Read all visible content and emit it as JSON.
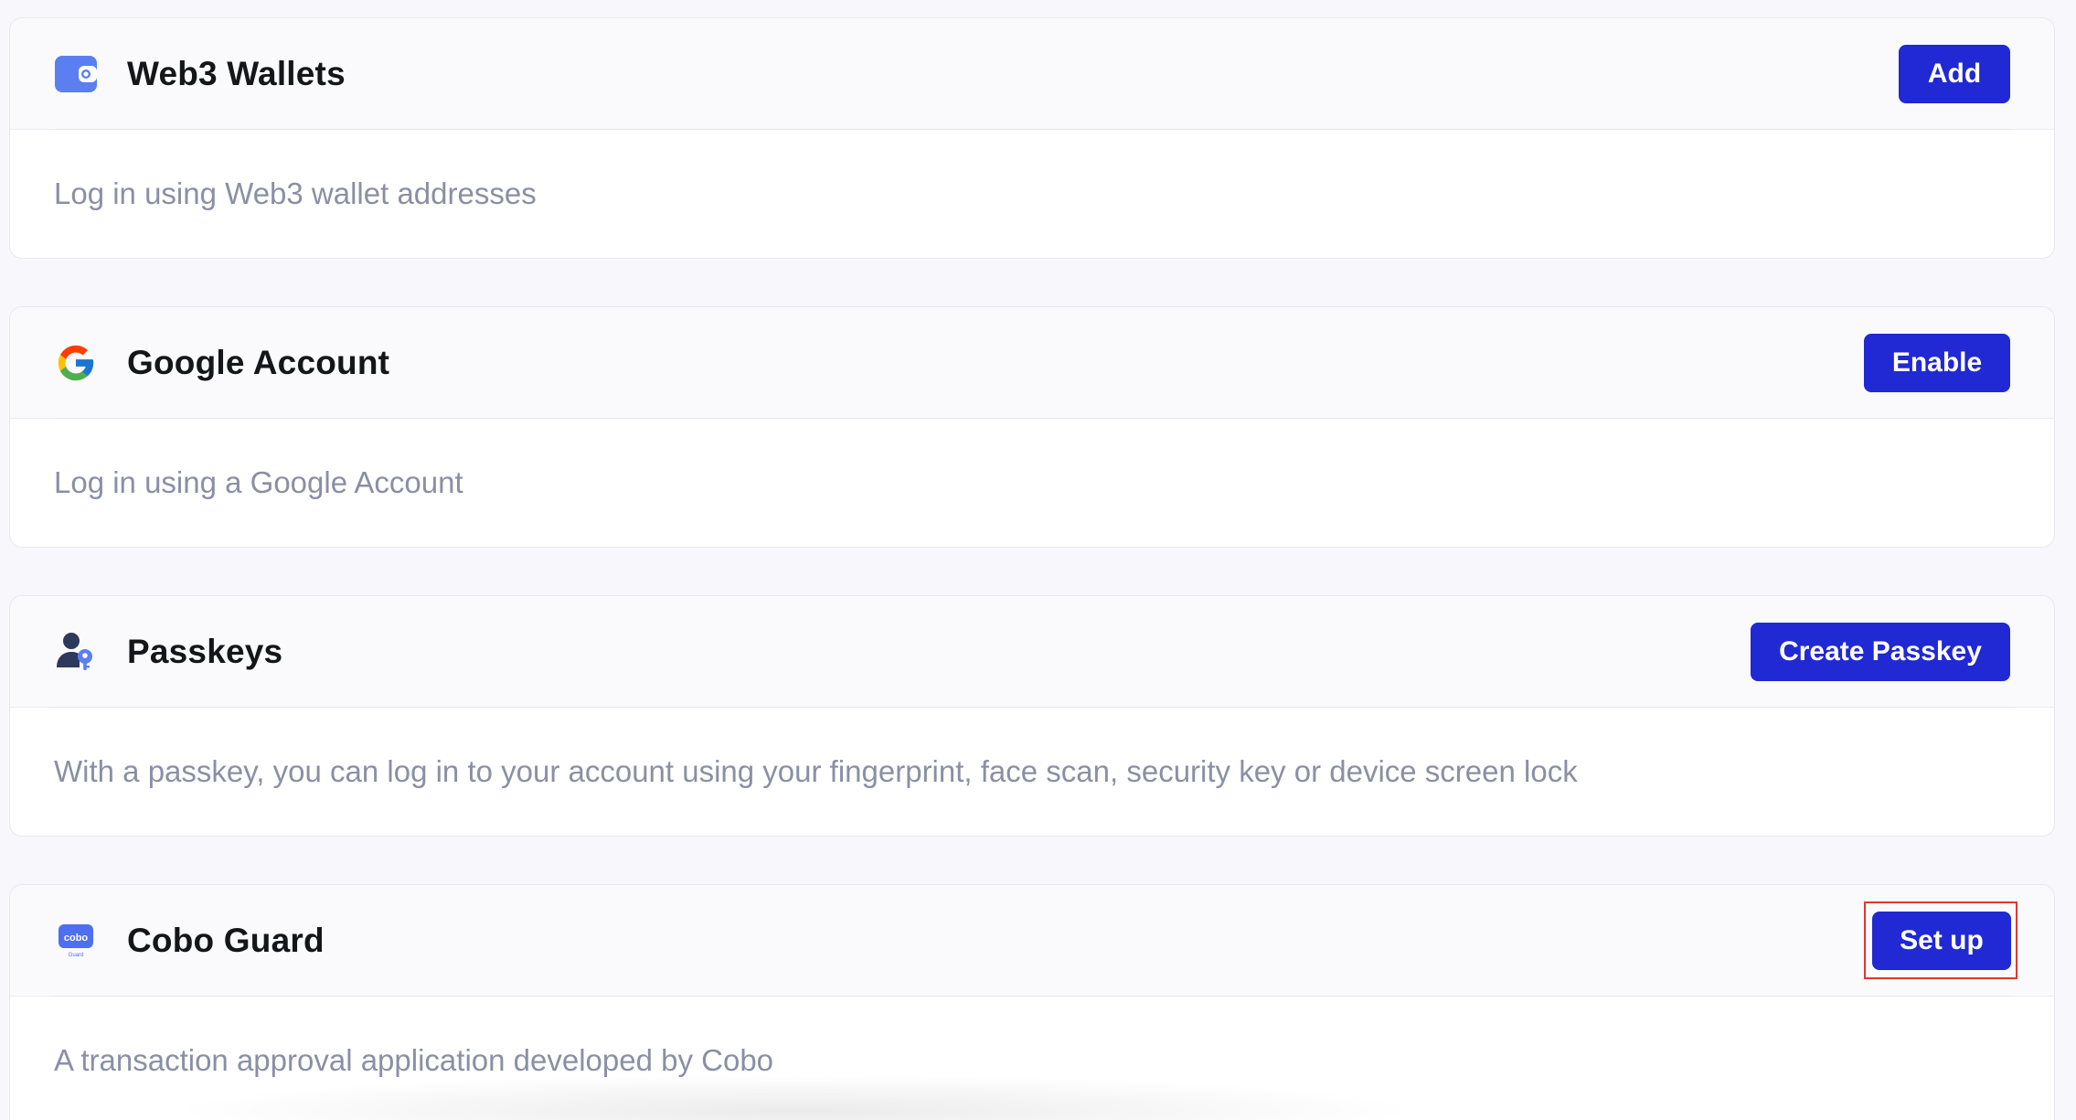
{
  "colors": {
    "accent": "#2029d3",
    "title": "#15161a",
    "description": "#8a90a3",
    "highlight": "#e0372f"
  },
  "cards": [
    {
      "icon": "wallet-icon",
      "title": "Web3 Wallets",
      "button_label": "Add",
      "description": "Log in using Web3 wallet addresses"
    },
    {
      "icon": "google-icon",
      "title": "Google Account",
      "button_label": "Enable",
      "description": "Log in using a Google Account"
    },
    {
      "icon": "passkey-user-icon",
      "title": "Passkeys",
      "button_label": "Create Passkey",
      "description": "With a passkey, you can log in to your account using your fingerprint, face scan, security key or device screen lock"
    },
    {
      "icon": "cobo-guard-icon",
      "icon_text": "cobo",
      "icon_subtext": "Guard",
      "title": "Cobo Guard",
      "button_label": "Set up",
      "description": "A transaction approval application developed by Cobo"
    }
  ]
}
